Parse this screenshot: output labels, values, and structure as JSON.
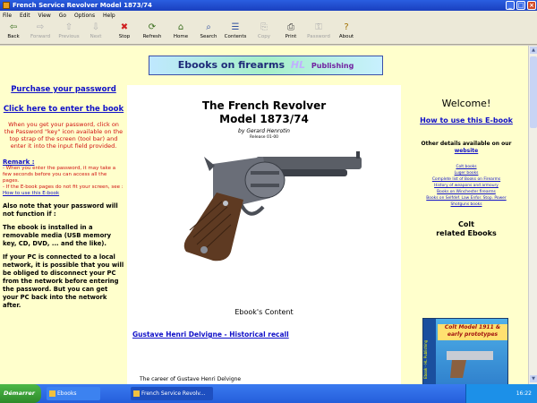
{
  "window": {
    "title": "French Service Revolver Model 1873/74"
  },
  "menu": [
    "File",
    "Edit",
    "View",
    "Go",
    "Options",
    "Help"
  ],
  "toolbar": [
    {
      "label": "Back",
      "icon": "back-arrow-icon",
      "glyph": "⇦",
      "enabled": true
    },
    {
      "label": "Forward",
      "icon": "forward-arrow-icon",
      "glyph": "⇨",
      "enabled": false
    },
    {
      "label": "Previous",
      "icon": "up-arrow-icon",
      "glyph": "⇧",
      "enabled": false
    },
    {
      "label": "Next",
      "icon": "down-arrow-icon",
      "glyph": "⇩",
      "enabled": false
    },
    {
      "label": "Stop",
      "icon": "stop-icon",
      "glyph": "✖",
      "enabled": true
    },
    {
      "label": "Refresh",
      "icon": "refresh-icon",
      "glyph": "⟳",
      "enabled": true
    },
    {
      "label": "Home",
      "icon": "home-icon",
      "glyph": "⌂",
      "enabled": true
    },
    {
      "label": "Search",
      "icon": "search-icon",
      "glyph": "⌕",
      "enabled": true
    },
    {
      "label": "Contents",
      "icon": "contents-icon",
      "glyph": "☰",
      "enabled": true
    },
    {
      "label": "Copy",
      "icon": "copy-icon",
      "glyph": "⎘",
      "enabled": false
    },
    {
      "label": "Print",
      "icon": "print-icon",
      "glyph": "⎙",
      "enabled": true
    },
    {
      "label": "Password",
      "icon": "key-icon",
      "glyph": "⚿",
      "enabled": false
    },
    {
      "label": "About",
      "icon": "question-icon",
      "glyph": "?",
      "enabled": true
    }
  ],
  "banner": {
    "text": "Ebooks on firearms",
    "brand": "HL",
    "publisher": "Publishing"
  },
  "left": {
    "purchase": "Purchase your password",
    "click_here": "Click here to enter the book",
    "instructions": "When you get your password, click on the Password \"key\" icon available on the top strap of the screen (tool bar) and enter it into the input field provided.",
    "remark_title": "Remark :",
    "remark1": "- When you enter the password, it may take a few seconds before you can access all the pages.",
    "remark2": "- If the E-book pages do not fit your screen, see :",
    "remark_link": "How to use this E-book",
    "p1": "Also note that your password will not function if :",
    "p2": "The ebook is installed in a removable media (USB memory key, CD, DVD, ... and the like).",
    "p3": "If your PC is connected to a local network, it is possible that you will be obliged to disconnect your PC from the network before entering the password. But you can get your PC back into the network after."
  },
  "center": {
    "title_line1": "The French Revolver",
    "title_line2": "Model 1873/74",
    "author": "by Gerard Henrotin",
    "release": "Release 01-00",
    "contents_heading": "Ebook's Content",
    "toc_link1": "Gustave Henri Delvigne - Historical recall",
    "toc_item2": "The career of Gustave Henri Delvigne"
  },
  "right": {
    "welcome": "Welcome!",
    "howto": "How to use this E-book",
    "other": "Other details available on our",
    "website": "website",
    "links": [
      "Colt books",
      "Luger books",
      "Complete list of Books on Firearms",
      "History of weapons and armoury",
      "Books on Winchester firearms",
      "Books on Selfdef. Law Enfor. Stop. Power",
      "Shotguns books"
    ],
    "colt_title_line1": "Colt",
    "colt_title_line2": "related Ebooks",
    "cover_title": "Colt Model 1911 & early prototypes",
    "cover_spine": "Ebook - HL Publishing"
  },
  "taskbar": {
    "start": "Démarrer",
    "tasks": [
      "Ebooks",
      "French Service Revolv..."
    ],
    "clock": "16:22"
  }
}
